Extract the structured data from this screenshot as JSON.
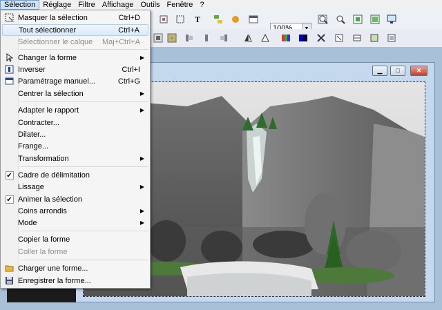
{
  "menubar": {
    "items": [
      "Sélection",
      "Réglage",
      "Filtre",
      "Affichage",
      "Outils",
      "Fenêtre",
      "?"
    ]
  },
  "toolbar": {
    "zoom_value": "100%"
  },
  "selection_menu": {
    "items": [
      {
        "label": "Masquer la sélection",
        "shortcut": "Ctrl+D",
        "icon": "mask-selection-icon"
      },
      {
        "label": "Tout sélectionner",
        "shortcut": "Ctrl+A",
        "highlighted": true
      },
      {
        "label": "Sélectionner le calque",
        "shortcut": "Maj+Ctrl+A",
        "disabled": true
      },
      {
        "label": "Changer la forme",
        "submenu": true,
        "icon": "arrow-pointer-icon"
      },
      {
        "label": "Inverser",
        "shortcut": "Ctrl+I",
        "icon": "invert-icon"
      },
      {
        "label": "Paramétrage manuel...",
        "shortcut": "Ctrl+G",
        "icon": "manual-settings-icon"
      },
      {
        "label": "Centrer la sélection",
        "submenu": true
      },
      {
        "label": "Adapter le rapport",
        "submenu": true
      },
      {
        "label": "Contracter..."
      },
      {
        "label": "Dilater..."
      },
      {
        "label": "Frange..."
      },
      {
        "label": "Transformation",
        "submenu": true
      },
      {
        "label": "Cadre de délimitation",
        "checked": true
      },
      {
        "label": "Lissage",
        "submenu": true
      },
      {
        "label": "Animer la sélection",
        "checked": true
      },
      {
        "label": "Coins arrondis",
        "submenu": true
      },
      {
        "label": "Mode",
        "submenu": true
      },
      {
        "label": "Copier la forme"
      },
      {
        "label": "Coller la forme",
        "disabled": true
      },
      {
        "label": "Charger une forme...",
        "icon": "folder-open-icon"
      },
      {
        "label": "Enregistrer la forme...",
        "icon": "save-disk-icon"
      }
    ]
  },
  "document_window": {
    "buttons": [
      "minimize",
      "maximize",
      "close"
    ]
  }
}
